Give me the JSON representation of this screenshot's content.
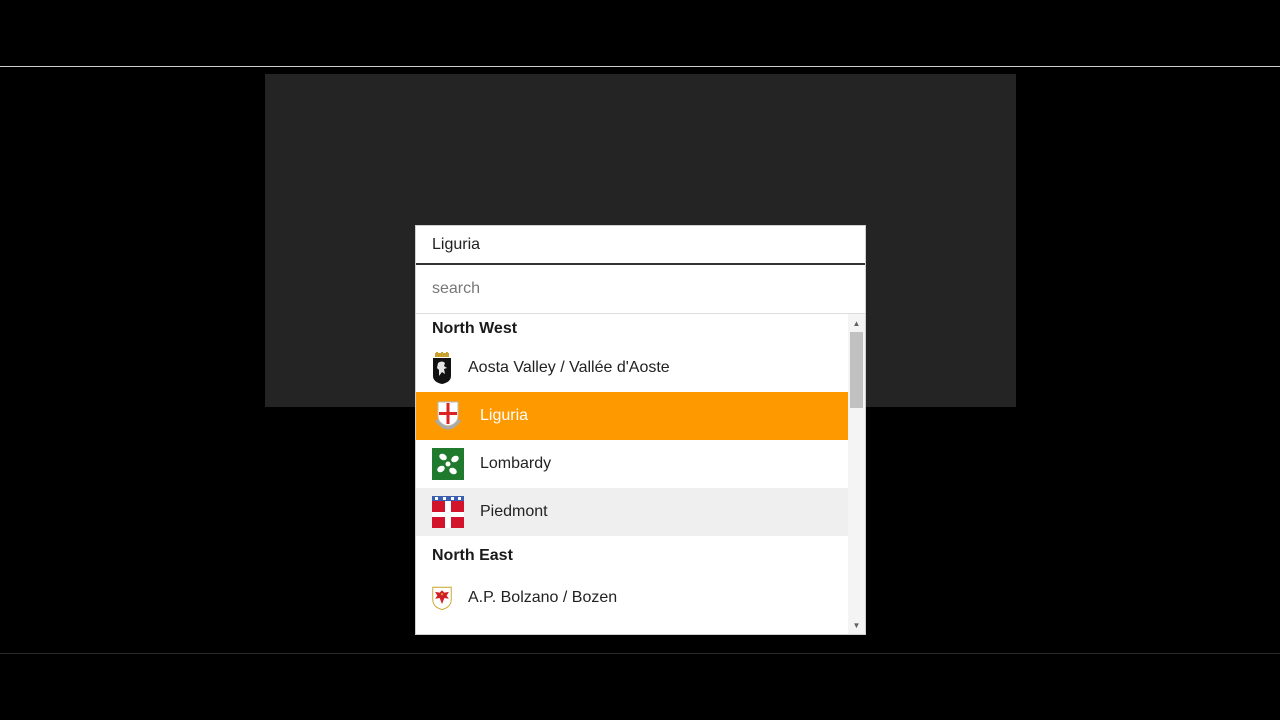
{
  "dropdown": {
    "selected_value": "Liguria",
    "search_placeholder": "search",
    "groups": [
      {
        "label": "North West",
        "options": [
          {
            "label": "Aosta Valley / Vallée d'Aoste",
            "icon": "aosta-valley-coat-of-arms-icon",
            "state": "normal"
          },
          {
            "label": "Liguria",
            "icon": "liguria-coat-of-arms-icon",
            "state": "selected"
          },
          {
            "label": "Lombardy",
            "icon": "lombardy-flag-icon",
            "state": "normal"
          },
          {
            "label": "Piedmont",
            "icon": "piedmont-flag-icon",
            "state": "hover"
          }
        ]
      },
      {
        "label": "North East",
        "options": [
          {
            "label": "A.P. Bolzano / Bozen",
            "icon": "bolzano-coat-of-arms-icon",
            "state": "normal"
          }
        ]
      }
    ]
  },
  "colors": {
    "accent": "#ff9900",
    "hover": "#efefef",
    "stage": "#242424",
    "background": "#000000"
  }
}
